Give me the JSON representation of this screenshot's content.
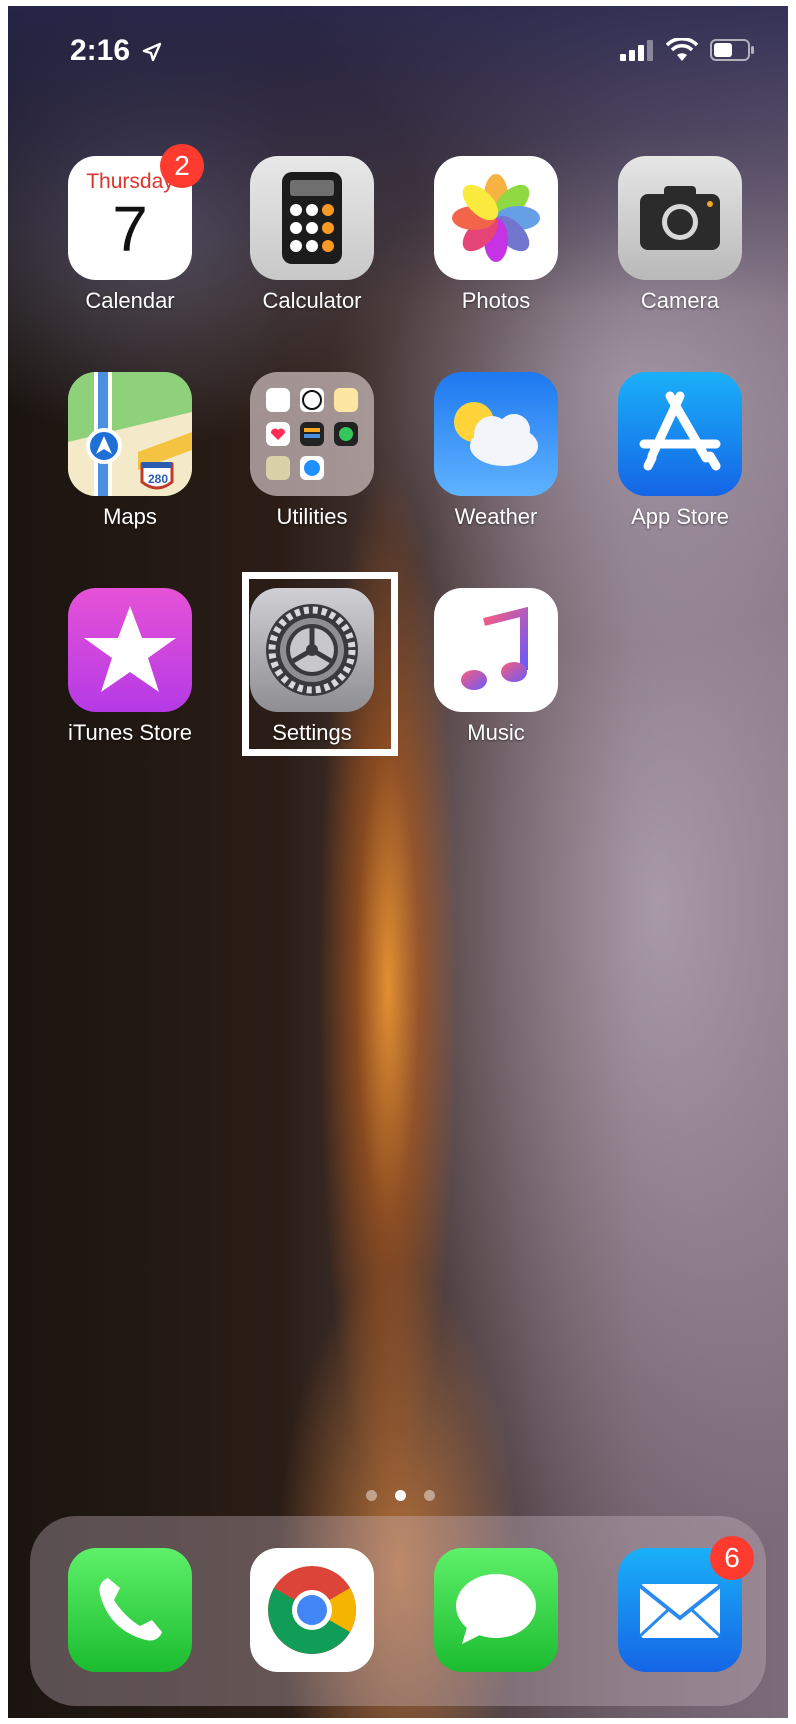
{
  "status_bar": {
    "time": "2:16"
  },
  "apps": {
    "calendar": {
      "label": "Calendar",
      "weekday": "Thursday",
      "day": "7",
      "badge": "2"
    },
    "calculator": {
      "label": "Calculator"
    },
    "photos": {
      "label": "Photos"
    },
    "camera": {
      "label": "Camera"
    },
    "maps": {
      "label": "Maps",
      "route_sign": "280"
    },
    "utilities": {
      "label": "Utilities"
    },
    "weather": {
      "label": "Weather"
    },
    "app_store": {
      "label": "App Store"
    },
    "itunes_store": {
      "label": "iTunes Store"
    },
    "settings": {
      "label": "Settings"
    },
    "music": {
      "label": "Music"
    }
  },
  "dock": {
    "phone": {},
    "chrome": {},
    "messages": {},
    "mail": {
      "badge": "6"
    }
  },
  "page_indicator": {
    "pages": 3,
    "current": 2
  },
  "colors": {
    "badge": "#ff3b30",
    "calendar_weekday": "#e0332c"
  }
}
